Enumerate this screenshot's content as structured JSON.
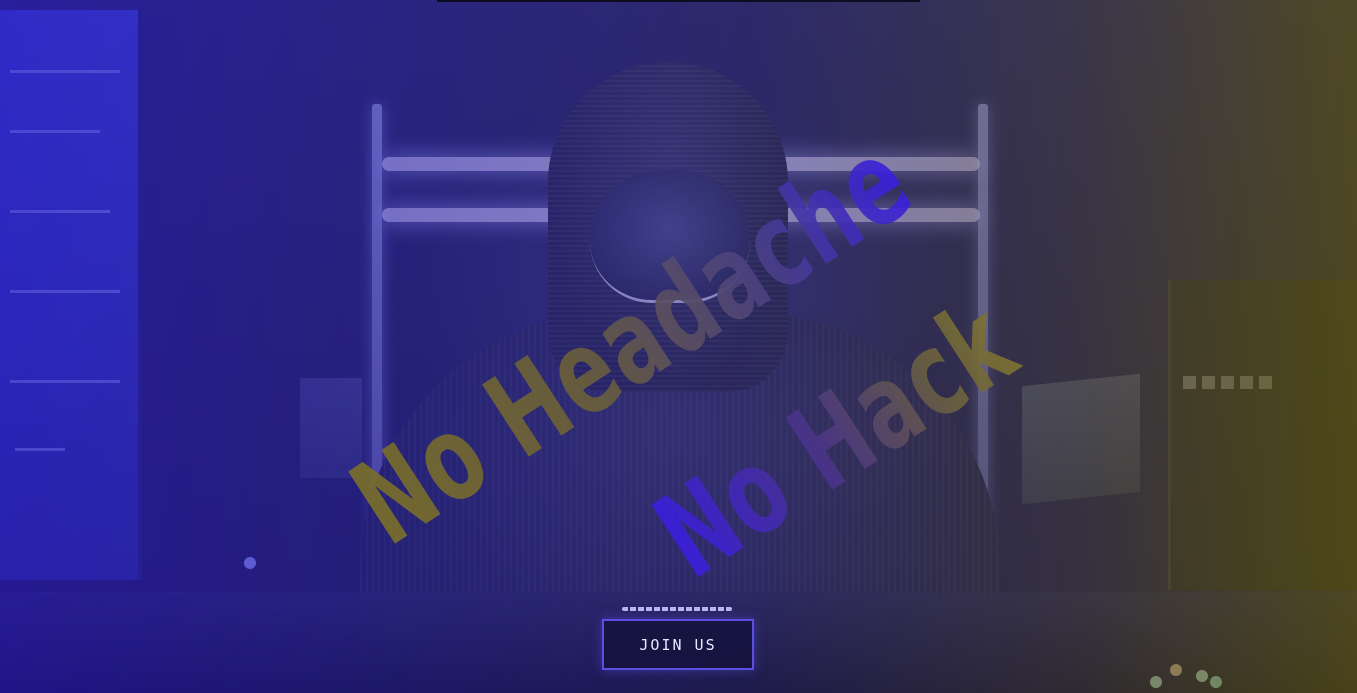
{
  "hero": {
    "headline_line1": "No Headache",
    "headline_line2": "No Hack",
    "cta_label": "JOIN US"
  },
  "colors": {
    "accent": "#5a4fe0",
    "wash_left": "#2814c8",
    "wash_right": "#5f550a",
    "headline_blue": "#3b1ee0",
    "headline_olive": "#7a6f2a"
  },
  "icons": {
    "divider": "dashed-divider"
  }
}
